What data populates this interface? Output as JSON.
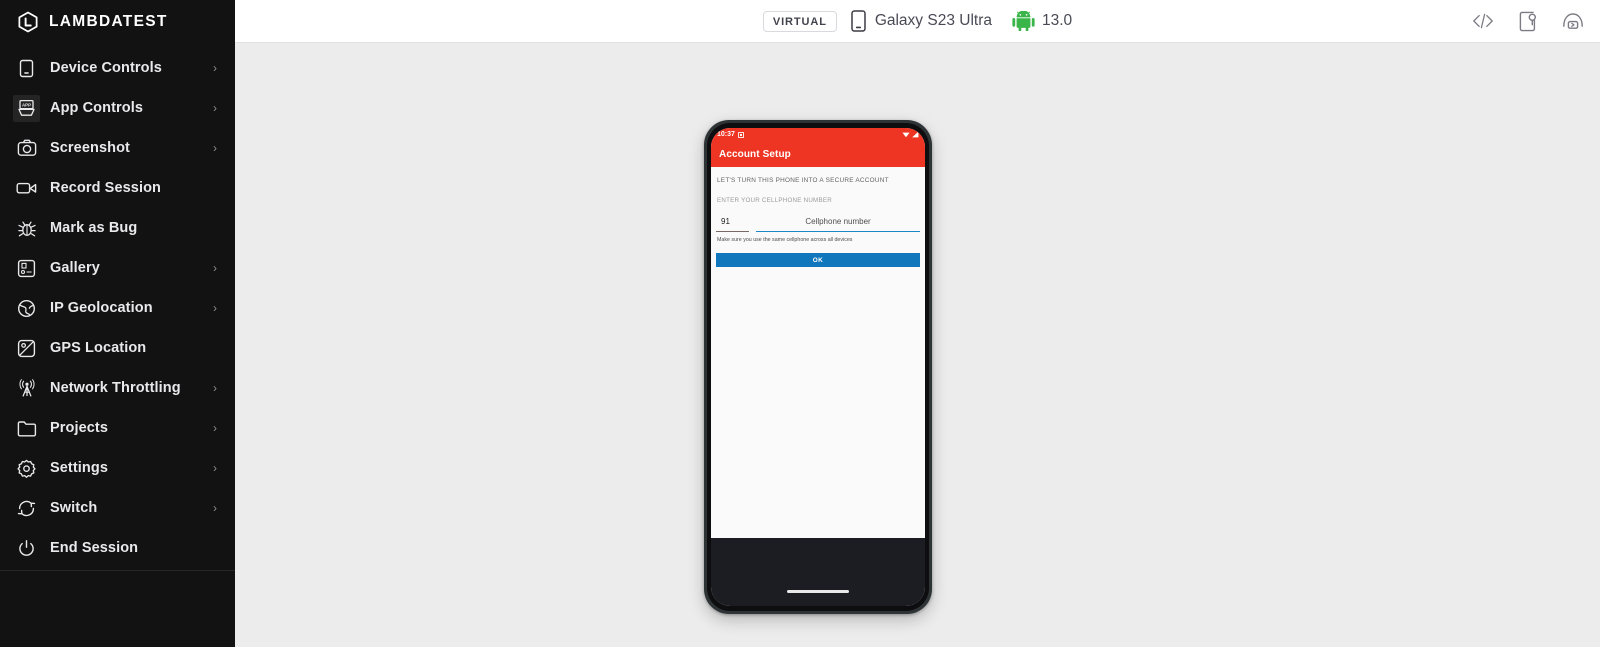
{
  "brand": {
    "name": "LAMBDATEST",
    "logo_icon": "lambdatest-logo-icon"
  },
  "sidebar": {
    "items": [
      {
        "label": "Device Controls",
        "icon": "device-controls-icon",
        "chevron": "›",
        "has_chevron": true
      },
      {
        "label": "App Controls",
        "icon": "app-controls-icon",
        "chevron": "›",
        "has_chevron": true
      },
      {
        "label": "Screenshot",
        "icon": "camera-icon",
        "chevron": "›",
        "has_chevron": true
      },
      {
        "label": "Record Session",
        "icon": "video-camera-icon",
        "chevron": "",
        "has_chevron": false
      },
      {
        "label": "Mark as Bug",
        "icon": "bug-icon",
        "chevron": "",
        "has_chevron": false
      },
      {
        "label": "Gallery",
        "icon": "gallery-icon",
        "chevron": "›",
        "has_chevron": true
      },
      {
        "label": "IP Geolocation",
        "icon": "globe-icon",
        "chevron": "›",
        "has_chevron": true
      },
      {
        "label": "GPS Location",
        "icon": "gps-location-icon",
        "chevron": "",
        "has_chevron": false
      },
      {
        "label": "Network Throttling",
        "icon": "network-tower-icon",
        "chevron": "›",
        "has_chevron": true
      },
      {
        "label": "Projects",
        "icon": "folder-icon",
        "chevron": "›",
        "has_chevron": true
      },
      {
        "label": "Settings",
        "icon": "gear-icon",
        "chevron": "›",
        "has_chevron": true
      },
      {
        "label": "Switch",
        "icon": "switch-arrows-icon",
        "chevron": "›",
        "has_chevron": true
      },
      {
        "label": "End Session",
        "icon": "power-icon",
        "chevron": "",
        "has_chevron": false
      }
    ]
  },
  "topbar": {
    "virtual_badge": "VIRTUAL",
    "device_icon": "mobile-device-icon",
    "device_name": "Galaxy S23 Ultra",
    "os_icon": "android-robot-icon",
    "os_version": "13.0",
    "actions": [
      {
        "name": "code-inspector-icon",
        "glyph": "</>"
      },
      {
        "name": "device-settings-icon",
        "glyph": ""
      },
      {
        "name": "appium-logs-icon",
        "glyph": ""
      }
    ]
  },
  "device_screen": {
    "status_bar": {
      "time": "10:37",
      "left_icon": "notification-icon",
      "wifi_icon": "wifi-icon",
      "signal_icon": "signal-icon"
    },
    "app_bar": {
      "title": "Account Setup"
    },
    "form": {
      "headline": "LET'S TURN THIS PHONE INTO A SECURE ACCOUNT",
      "sublabel": "ENTER YOUR CELLPHONE NUMBER",
      "country_code": "91",
      "phone_placeholder": "Cellphone number",
      "helper": "Make sure you use the same cellphone across all devices",
      "submit_label": "OK"
    },
    "nav_bar": {
      "gesture_pill": "gesture-pill-icon"
    }
  },
  "colors": {
    "sidebar_bg": "#121212",
    "main_bg": "#ececec",
    "app_bar_red": "#ee3524",
    "ok_button_blue": "#1077bc",
    "input_underline_blue": "#1e88c7",
    "android_green": "#3ddc84"
  }
}
